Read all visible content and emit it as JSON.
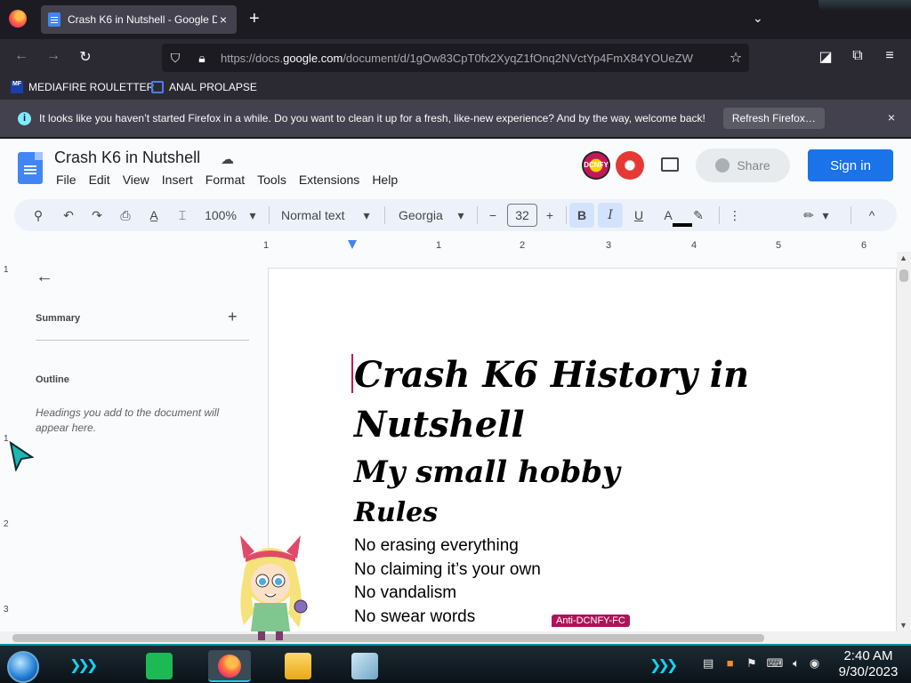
{
  "browser": {
    "tab_title": "Crash K6 in Nutshell - Google D",
    "tab_close": "×",
    "new_tab": "+",
    "tab_list": "⌄",
    "url_host": "https://docs.",
    "url_domain": "google.com",
    "url_path": "/document/d/1gOw83CpT0fx2XyqZ1fOnq2NVctYp4FmX84YOUeZW",
    "back_icon": "←",
    "forward_icon": "→",
    "reload_icon": "↻",
    "star_icon": "☆",
    "pocket_icon": "◪",
    "extensions_icon": "⧉",
    "menu_icon": "≡"
  },
  "bookmarks": [
    {
      "label": "MEDIAFIRE ROULETTER",
      "icon": "MF"
    },
    {
      "label": "ANAL PROLAPSE",
      "icon": ""
    }
  ],
  "notification": {
    "message": "It looks like you haven’t started Firefox in a while. Do you want to clean it up for a fresh, like-new experience? And by the way, welcome back!",
    "refresh_button": "Refresh Firefox…",
    "close": "×"
  },
  "docs": {
    "title": "Crash K6 in Nutshell",
    "menus": [
      "File",
      "Edit",
      "View",
      "Insert",
      "Format",
      "Tools",
      "Extensions",
      "Help"
    ],
    "share_label": "Share",
    "signin_label": "Sign in",
    "avatar1": "DCNFY",
    "toolbar": {
      "zoom": "100%",
      "style": "Normal text",
      "font": "Georgia",
      "font_size": "32",
      "minus": "−",
      "plus": "+",
      "bold": "B",
      "italic": "I",
      "underline": "U",
      "text_color": "A",
      "caret": "▾",
      "more": "⋮",
      "collapse": "^"
    },
    "ruler_ticks": [
      "1",
      "1",
      "2",
      "3",
      "4",
      "5",
      "6"
    ],
    "vruler_ticks": [
      "1",
      "1",
      "2",
      "3"
    ],
    "sidebar": {
      "back": "←",
      "summary_label": "Summary",
      "summary_add": "+",
      "outline_label": "Outline",
      "outline_hint": "Headings you add to the document will appear here."
    },
    "document": {
      "heading1": "Crash K6 History in Nutshell",
      "heading2": "My small hobby",
      "heading3": "Rules",
      "rules": [
        "No erasing everything",
        "No claiming it’s your own",
        "No vandalism",
        "No swear words"
      ],
      "collaborator_tag": "Anti-DCNFY-FC"
    }
  },
  "taskbar": {
    "clock_time": "2:40 AM",
    "clock_date": "9/30/2023"
  },
  "colors": {
    "firefox_dark": "#1c1b22",
    "docs_blue": "#1a73e8",
    "cursor_magenta": "#c2185b",
    "taskbar_accent": "#0fd4f0"
  }
}
